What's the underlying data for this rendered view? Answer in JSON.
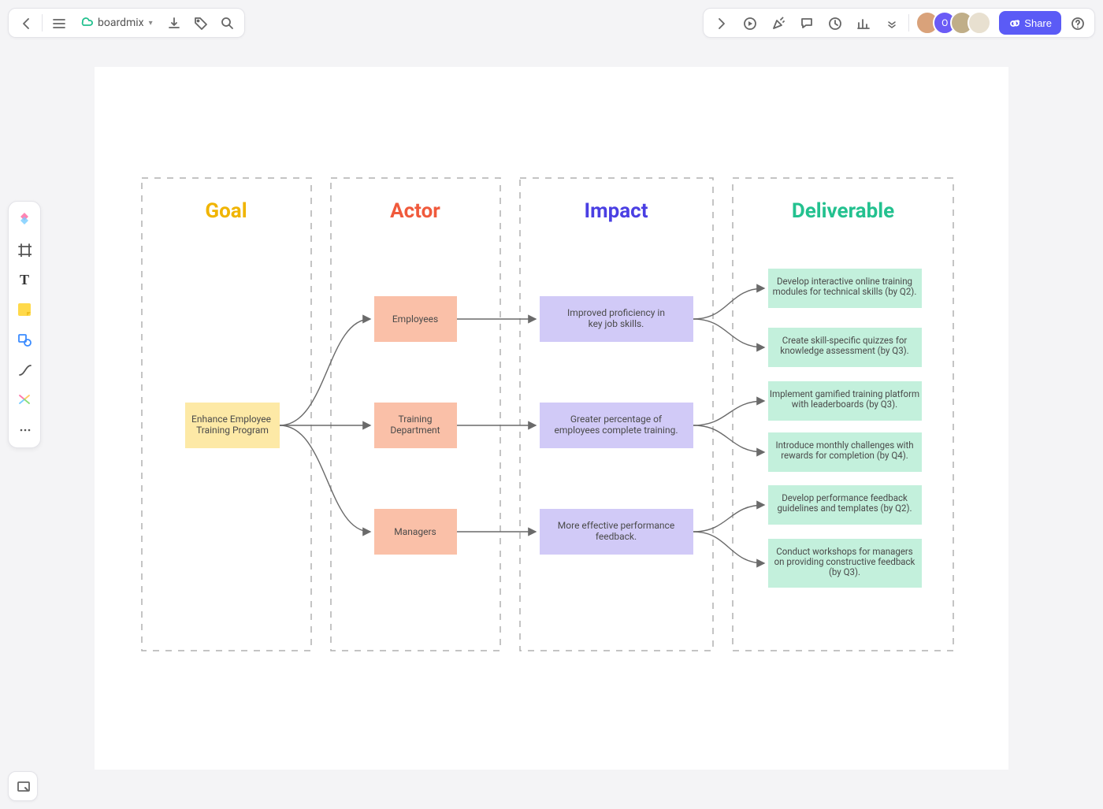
{
  "app": {
    "name": "boardmix"
  },
  "header": {
    "share_label": "Share"
  },
  "avatars": [
    {
      "bg": "#d9a27a",
      "initial": ""
    },
    {
      "bg": "#6b5bf6",
      "initial": "O"
    },
    {
      "bg": "#c0ae88",
      "initial": ""
    },
    {
      "bg": "#e0e0e0",
      "initial": ""
    }
  ],
  "columns": {
    "goal": {
      "title": "Goal",
      "color": "#f0b400"
    },
    "actor": {
      "title": "Actor",
      "color": "#f05a3c"
    },
    "impact": {
      "title": "Impact",
      "color": "#4a3fe3"
    },
    "deliverable": {
      "title": "Deliverable",
      "color": "#23c18f"
    }
  },
  "goal_node": {
    "text": "Enhance Employee Training Program"
  },
  "actors": [
    {
      "label": "Employees"
    },
    {
      "label": "Training Department"
    },
    {
      "label": "Managers"
    }
  ],
  "impacts": [
    {
      "text": "Improved proficiency in key job skills."
    },
    {
      "text": "Greater percentage of employees complete training."
    },
    {
      "text": "More effective performance feedback."
    }
  ],
  "deliverables": [
    {
      "for": 0,
      "text": "Develop interactive online training modules for technical skills (by Q2)."
    },
    {
      "for": 0,
      "text": "Create skill-specific quizzes for knowledge assessment (by Q3)."
    },
    {
      "for": 1,
      "text": "Implement gamified training platform with leaderboards (by Q3)."
    },
    {
      "for": 1,
      "text": "Introduce monthly challenges with rewards for completion (by Q4)."
    },
    {
      "for": 2,
      "text": "Develop performance feedback guidelines and templates (by Q2)."
    },
    {
      "for": 2,
      "text": "Conduct workshops for managers on providing constructive feedback (by Q3)."
    }
  ]
}
